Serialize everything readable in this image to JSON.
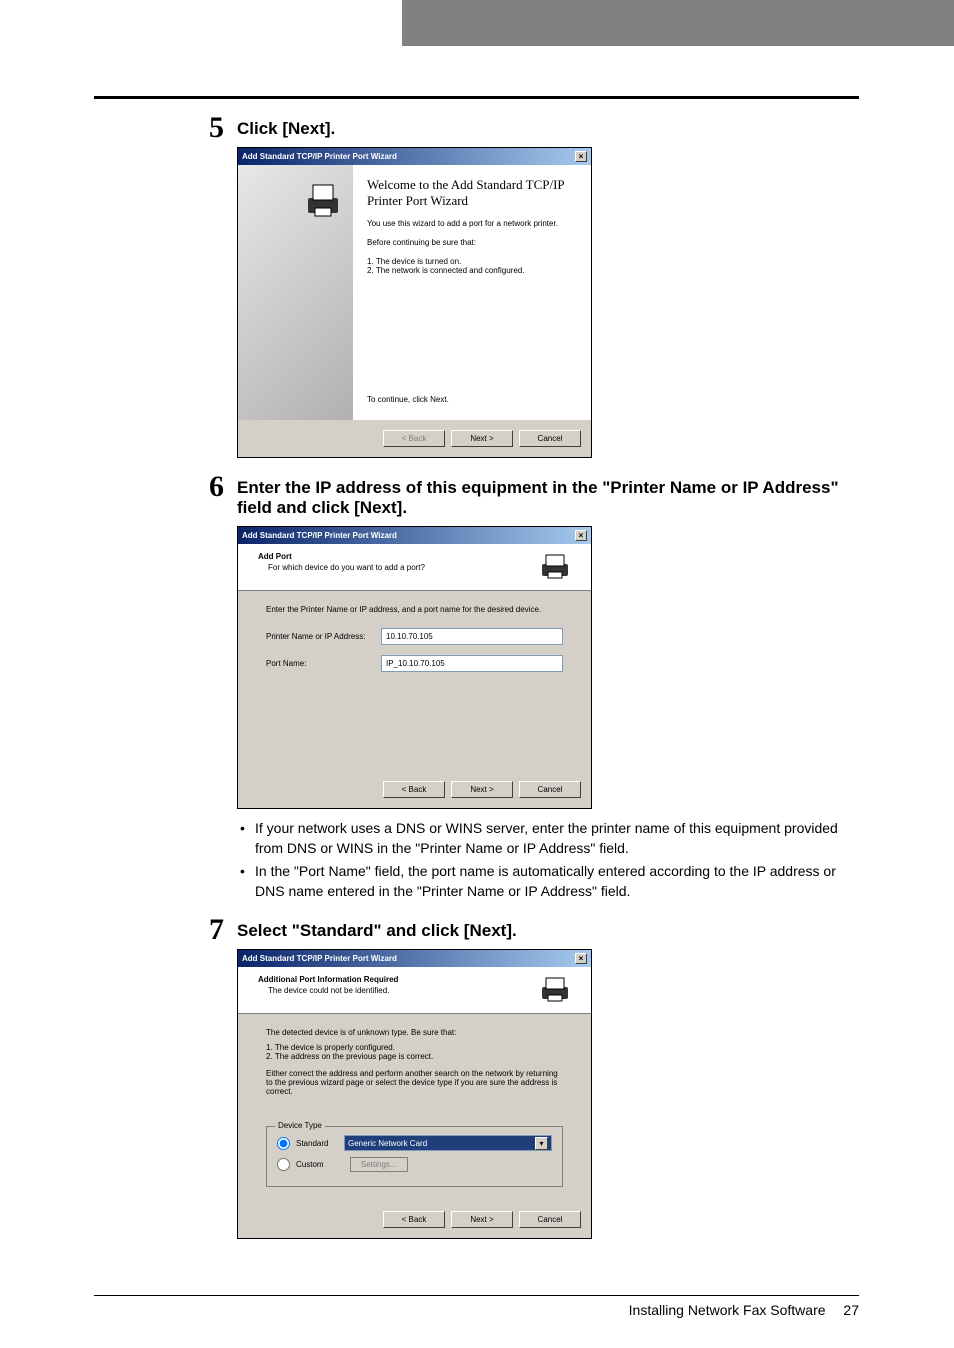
{
  "top_bar": {},
  "steps": {
    "s5": {
      "num": "5",
      "title": "Click [Next].",
      "dialog": {
        "title": "Add Standard TCP/IP Printer Port Wizard",
        "welcome_title": "Welcome to the Add Standard TCP/IP Printer Port Wizard",
        "welcome_text": "You use this wizard to add a port for a network printer.",
        "before_text": "Before continuing be sure that:",
        "item1": "The device is turned on.",
        "item2": "The network is connected and configured.",
        "continue_text": "To continue, click Next.",
        "back": "< Back",
        "next": "Next >",
        "cancel": "Cancel"
      }
    },
    "s6": {
      "num": "6",
      "title": "Enter the IP address of this equipment in the \"Printer Name or IP Address\" field and click [Next].",
      "dialog": {
        "title": "Add Standard TCP/IP Printer Port Wizard",
        "section_title": "Add Port",
        "section_sub": "For which device do you want to add a port?",
        "instruction": "Enter the Printer Name or IP address, and a port name for the desired device.",
        "field1_label": "Printer Name or IP Address:",
        "field1_value": "10.10.70.105",
        "field2_label": "Port Name:",
        "field2_value": "IP_10.10.70.105",
        "back": "< Back",
        "next": "Next >",
        "cancel": "Cancel"
      },
      "bullets": [
        "If your network uses a DNS or WINS server, enter the printer name of this equipment provided from DNS or WINS in the \"Printer Name or IP Address\" field.",
        "In the \"Port Name\" field, the port name is automatically entered according to the IP address or DNS name entered in the \"Printer Name or IP Address\" field."
      ]
    },
    "s7": {
      "num": "7",
      "title": "Select \"Standard\" and click [Next].",
      "dialog": {
        "title": "Add Standard TCP/IP Printer Port Wizard",
        "section_title": "Additional Port Information Required",
        "section_sub": "The device could not be identified.",
        "info1": "The detected device is of unknown type.  Be sure that:",
        "info_item1": "The device is properly configured.",
        "info_item2": "The address on the previous page is correct.",
        "info2": "Either correct the address and perform another search on the network by returning to the previous wizard page or select the device type if you are sure the address is correct.",
        "group_title": "Device Type",
        "radio_standard": "Standard",
        "select_value": "Generic Network Card",
        "radio_custom": "Custom",
        "settings_btn": "Settings...",
        "back": "< Back",
        "next": "Next >",
        "cancel": "Cancel"
      }
    }
  },
  "footer": {
    "text": "Installing Network Fax Software",
    "page": "27"
  }
}
